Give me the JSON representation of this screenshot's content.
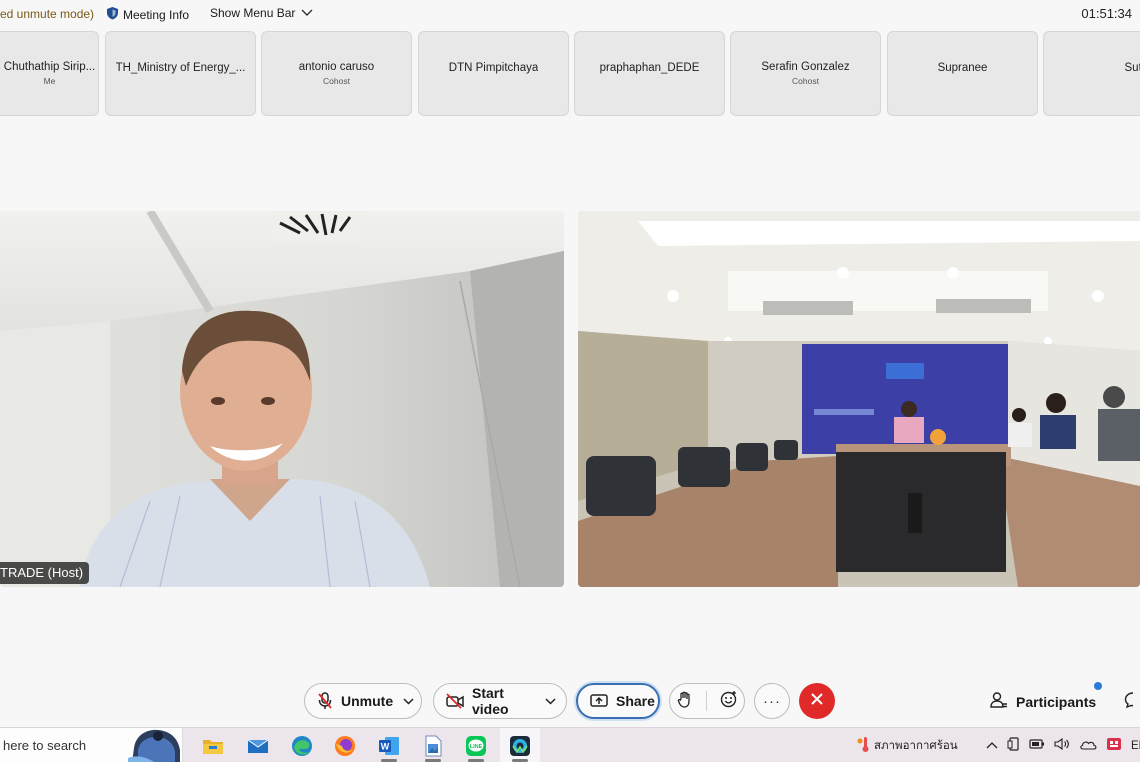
{
  "topbar": {
    "mode_text": "ed unmute mode)",
    "meeting_info_label": "Meeting Info",
    "menu_bar_label": "Show Menu Bar",
    "clock": "01:51:34"
  },
  "participants_strip": [
    {
      "name": "Chuthathip Sirip...",
      "role": "Me"
    },
    {
      "name": "TH_Ministry of Energy_...",
      "role": ""
    },
    {
      "name": "antonio caruso",
      "role": "Cohost"
    },
    {
      "name": "DTN Pimpitchaya",
      "role": ""
    },
    {
      "name": "praphaphan_DEDE",
      "role": ""
    },
    {
      "name": "Serafin Gonzalez",
      "role": "Cohost"
    },
    {
      "name": "Supranee",
      "role": ""
    },
    {
      "name": "Sutthasin",
      "role": ""
    }
  ],
  "video": {
    "host_label": "TRADE (Host)"
  },
  "controls": {
    "unmute_label": "Unmute",
    "start_video_label": "Start video",
    "share_label": "Share",
    "more_label": "···",
    "participants_label": "Participants"
  },
  "taskbar": {
    "search_placeholder": "here to search",
    "weather_text": "สภาพอากาศร้อน",
    "language": "ENG"
  },
  "colors": {
    "leave": "#e02929",
    "share_border": "#3a6fb3",
    "notif": "#2a7ad6"
  }
}
